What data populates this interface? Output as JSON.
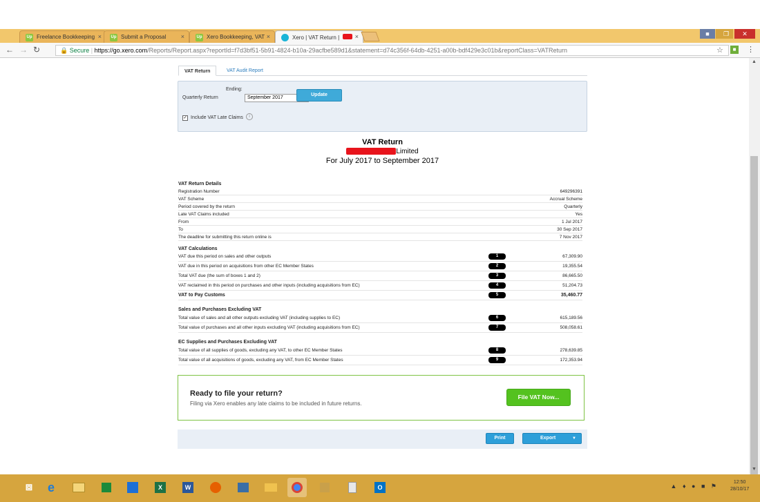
{
  "browser": {
    "tabs": [
      {
        "label": "Freelance Bookkeeping",
        "icon": "upwork-favicon"
      },
      {
        "label": "Submit a Proposal",
        "icon": "upwork-favicon"
      },
      {
        "label": "Xero Bookkeeping, VAT",
        "icon": "upwork-favicon"
      },
      {
        "label": "Xero | VAT Return |",
        "icon": "xero-favicon"
      }
    ],
    "close_glyph": "×",
    "favicon_glyph": "Up",
    "secure_label": "Secure",
    "url_host": "https://go.xero.com",
    "url_path": "/Reports/Report.aspx?reportId=f7d3bf51-5b91-4824-b10a-29acfbe589d1&statement=d74c356f-64db-4251-a00b-bdf429e3c01b&reportClass=VATReturn"
  },
  "report_tabs": {
    "active": "VAT Return",
    "other": "VAT Audit Report"
  },
  "filter": {
    "ending_label": "Ending:",
    "period_label": "Quarterly Return",
    "selected_period": "September 2017",
    "update_label": "Update",
    "late_claims_label": "Include VAT Late Claims",
    "late_claims_checked": true
  },
  "report": {
    "title": "VAT Return",
    "company_suffix": "Limited",
    "period": "For July 2017 to September 2017",
    "details_title": "VAT Return Details",
    "details": [
      {
        "label": "Registration Number",
        "value": "649296391"
      },
      {
        "label": "VAT Scheme",
        "value": "Accrual Scheme"
      },
      {
        "label": "Period covered by the return",
        "value": "Quarterly"
      },
      {
        "label": "Late VAT Claims included",
        "value": "Yes"
      },
      {
        "label": "From",
        "value": "1 Jul 2017"
      },
      {
        "label": "To",
        "value": "30 Sep 2017"
      },
      {
        "label": "The deadline for submitting this return online is",
        "value": "7 Nov 2017"
      }
    ],
    "calc_title": "VAT Calculations",
    "calc": [
      {
        "box": "1",
        "label": "VAT due this period on sales and other outputs",
        "value": "67,309.90"
      },
      {
        "box": "2",
        "label": "VAT due in this period on acquisitions from other EC Member States",
        "value": "19,355.54"
      },
      {
        "box": "3",
        "label": "Total VAT due (the sum of boxes 1 and 2)",
        "value": "86,665.50"
      },
      {
        "box": "4",
        "label": "VAT reclaimed in this period on purchases and other inputs (including acquisitions from EC)",
        "value": "51,204.73"
      },
      {
        "box": "5",
        "label": "VAT to Pay Customs",
        "value": "35,460.77"
      }
    ],
    "sales_title": "Sales and Purchases Excluding VAT",
    "sales": [
      {
        "box": "6",
        "label": "Total value of sales and all other outputs excluding VAT (including supplies to EC)",
        "value": "615,189.56"
      },
      {
        "box": "7",
        "label": "Total value of purchases and all other inputs excluding VAT (including acquisitions from EC)",
        "value": "508,058.61"
      }
    ],
    "ec_title": "EC Supplies and Purchases Excluding VAT",
    "ec": [
      {
        "box": "8",
        "label": "Total value of all supplies of goods, excluding any VAT, to other EC Member States",
        "value": "278,639.85"
      },
      {
        "box": "9",
        "label": "Total value of all acquisitions of goods, excluding any VAT, from EC Member States",
        "value": "172,353.94"
      }
    ]
  },
  "cta": {
    "heading": "Ready to file your return?",
    "subtext": "Filing via Xero enables any late claims to be included in future returns.",
    "button": "File VAT Now..."
  },
  "footer": {
    "print": "Print",
    "export": "Export"
  },
  "taskbar": {
    "time": "12:50",
    "date": "28/10/17"
  },
  "colors": {
    "tabbar": "#f2c76c",
    "taskbar": "#d6a53e",
    "primary_button": "#2d9fd9",
    "file_button": "#54c21f"
  }
}
